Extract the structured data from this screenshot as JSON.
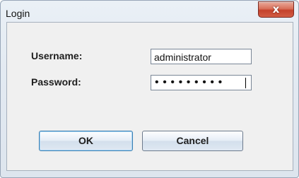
{
  "window": {
    "title": "Login",
    "close_glyph": "x"
  },
  "form": {
    "username_label": "Username:",
    "username_value": "administrator",
    "password_label": "Password:",
    "password_mask": "•••••••••"
  },
  "buttons": {
    "ok_label": "OK",
    "cancel_label": "Cancel"
  },
  "colors": {
    "close_button": "#c4412b",
    "client_background": "#f0f0f0",
    "default_button_border": "#3c7fb1"
  }
}
